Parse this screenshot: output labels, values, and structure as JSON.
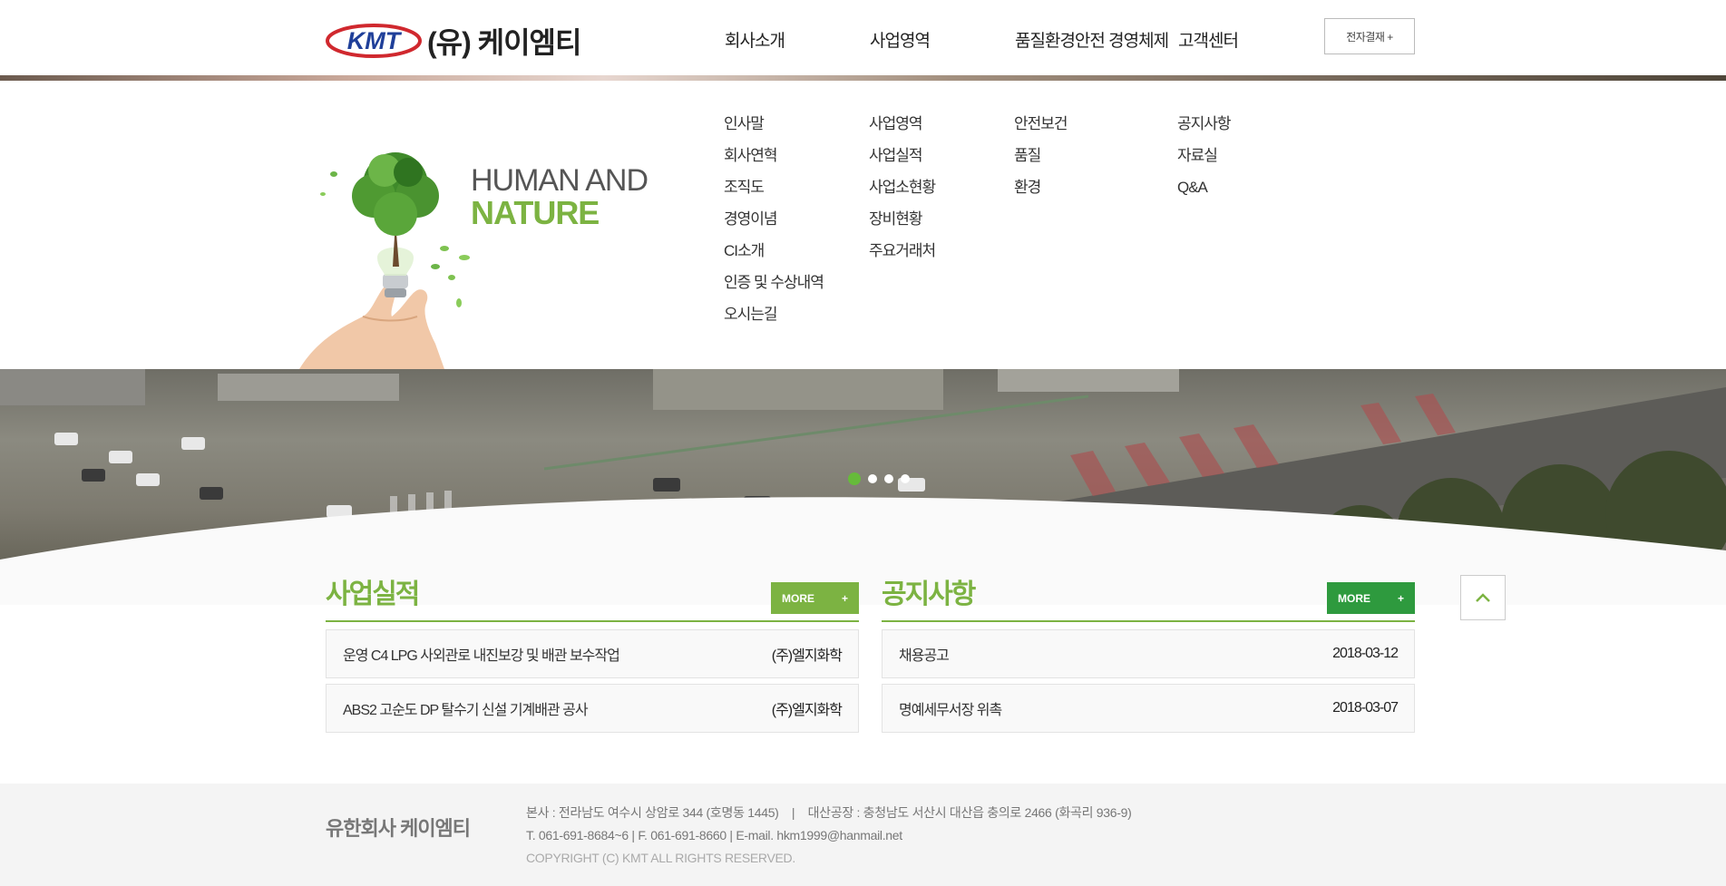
{
  "header": {
    "logo_mark": "KMT",
    "logo_text": "(유) 케이엠티",
    "nav": [
      "회사소개",
      "사업영역",
      "품질환경안전 경영체제",
      "고객센터"
    ],
    "pay_button": "전자결재 +"
  },
  "mega_menu": {
    "slogan_line1": "HUMAN AND",
    "slogan_line2": "NATURE",
    "columns": [
      [
        "인사말",
        "회사연혁",
        "조직도",
        "경영이념",
        "CI소개",
        "인증 및 수상내역",
        "오시는길"
      ],
      [
        "사업영역",
        "사업실적",
        "사업소현황",
        "장비현황",
        "주요거래처"
      ],
      [
        "안전보건",
        "품질",
        "환경"
      ],
      [
        "공지사항",
        "자료실",
        "Q&A"
      ]
    ]
  },
  "banner": {
    "slide_count": 4,
    "active_slide": 1
  },
  "panels": {
    "business": {
      "title": "사업실적",
      "more": "MORE",
      "more_plus": "+",
      "rows": [
        {
          "title": "운영 C4 LPG 사외관로 내진보강 및 배관 보수작업",
          "right": "(주)엘지화학"
        },
        {
          "title": "ABS2 고순도 DP 탈수기 신설 기계배관 공사",
          "right": "(주)엘지화학"
        }
      ]
    },
    "notice": {
      "title": "공지사항",
      "more": "MORE",
      "more_plus": "+",
      "rows": [
        {
          "title": "채용공고",
          "right": "2018-03-12"
        },
        {
          "title": "명예세무서장 위촉",
          "right": "2018-03-07"
        }
      ]
    }
  },
  "footer": {
    "brand": "유한회사 케이엠티",
    "address": "본사 : 전라남도 여수시 상암로 344 (호명동 1445)    |    대산공장 : 충청남도 서산시 대산읍 충의로 2466 (화곡리 936-9)",
    "contact": "T. 061-691-8684~6 | F. 061-691-8660 | E-mail. hkm1999@hanmail.net",
    "copyright": "COPYRIGHT (C) KMT ALL RIGHTS RESERVED."
  },
  "colors": {
    "brand_green": "#7cb342",
    "dark_green": "#2e9a3e",
    "logo_red": "#d0282e",
    "logo_blue": "#1f3f99"
  }
}
